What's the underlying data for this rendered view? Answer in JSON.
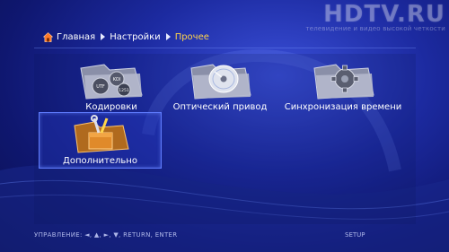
{
  "watermark": {
    "logo": "HDTV.RU",
    "subtitle": "телевидение и видео высокой четкости"
  },
  "breadcrumb": {
    "home": "Главная",
    "settings": "Настройки",
    "current": "Прочее"
  },
  "tiles": [
    {
      "label": "Кодировки",
      "icon": "encoding-icon"
    },
    {
      "label": "Оптический привод",
      "icon": "disc-icon"
    },
    {
      "label": "Синхронизация времени",
      "icon": "gear-icon"
    },
    {
      "label": "Дополнительно",
      "icon": "toolbox-icon",
      "selected": true
    }
  ],
  "footer": {
    "hint": "УПРАВЛЕНИЕ:  ◄, ▲, ►, ▼, RETURN, ENTER",
    "right": "SETUP"
  },
  "colors": {
    "accent": "#ffd44a",
    "background": "#1c2aa0",
    "selection_border": "#5f7cff"
  }
}
